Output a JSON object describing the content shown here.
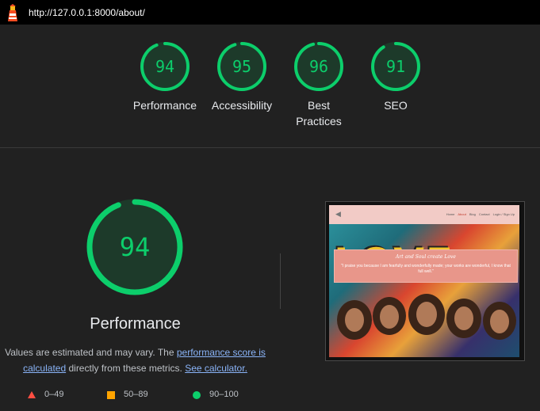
{
  "url": "http://127.0.0.1:8000/about/",
  "colors": {
    "pass": "#0cce6b",
    "pass_bg": "#1d3a2a",
    "average": "#ffa400",
    "fail": "#ff4e42"
  },
  "categories": [
    {
      "label": "Performance",
      "score": 94
    },
    {
      "label": "Accessibility",
      "score": 95
    },
    {
      "label": "Best Practices",
      "score": 96
    },
    {
      "label": "SEO",
      "score": 91
    }
  ],
  "main": {
    "score": 94,
    "title": "Performance",
    "desc_part1": "Values are estimated and may vary. The ",
    "link_score": "performance score is calculated",
    "desc_part2": " directly from these metrics. ",
    "link_calc": "See calculator."
  },
  "legend": [
    {
      "icon": "triangle-icon",
      "range": "0–49"
    },
    {
      "icon": "square-icon",
      "range": "50–89"
    },
    {
      "icon": "circle-icon",
      "range": "90–100"
    }
  ],
  "screenshot": {
    "nav_links": [
      "Home",
      "About",
      "Blog",
      "Contact",
      "Login / Sign Up"
    ],
    "banner_title": "Art and Soul create Love",
    "banner_text": "\"I praise you because I am fearfully and wonderfully made; your works are wonderful, I know that full well.\"",
    "artwork_word": "LOVE"
  }
}
